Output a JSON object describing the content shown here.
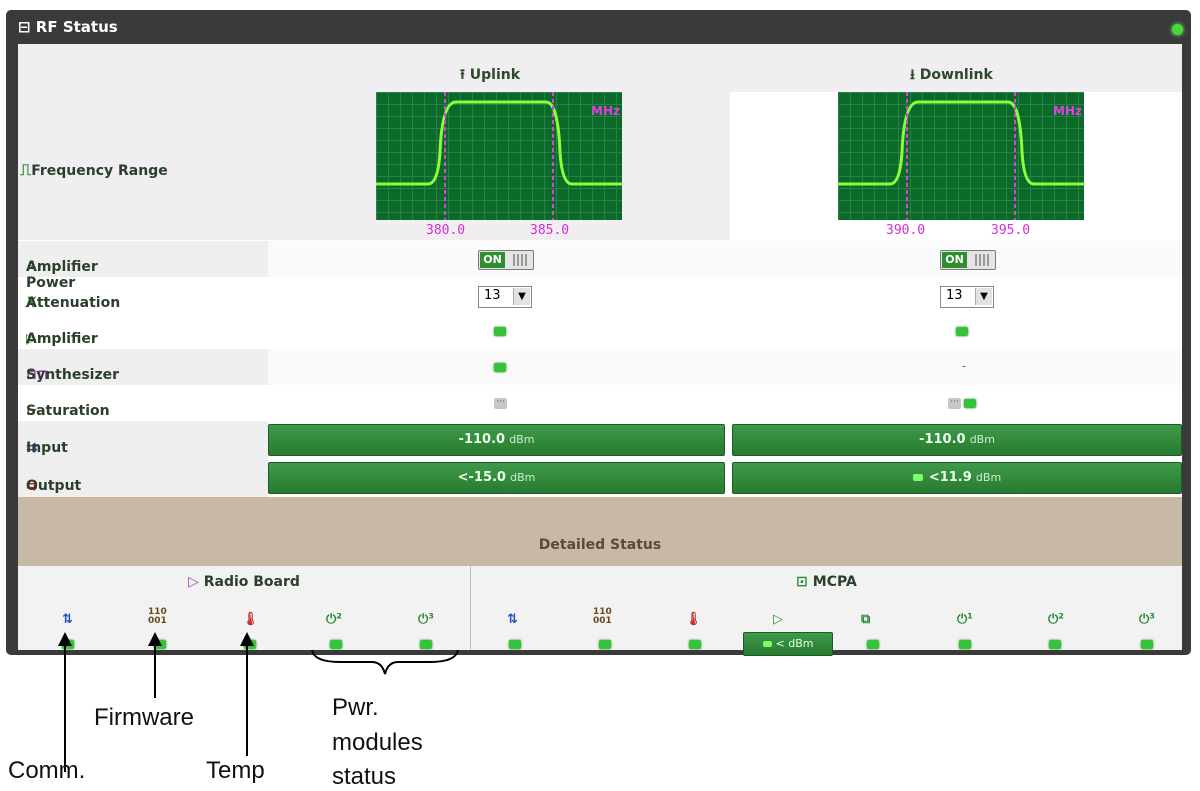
{
  "panel": {
    "title": "RF Status",
    "collapse_icon": "minus-box-icon"
  },
  "freq": {
    "uplink_label": "Uplink",
    "downlink_label": "Downlink",
    "row_label": "Frequency Range",
    "unit": "MHz",
    "uplink_low": "380.0",
    "uplink_high": "385.0",
    "downlink_low": "390.0",
    "downlink_high": "395.0"
  },
  "rows": {
    "amp_power": {
      "label": "Amplifier Power",
      "on": "ON"
    },
    "attenuation": {
      "label": "Attenuation",
      "uplink": "13",
      "downlink": "13"
    },
    "amplifier": {
      "label": "Amplifier"
    },
    "synth": {
      "label": "Synthesizer",
      "downlink": "-"
    },
    "saturation": {
      "label": "Saturation"
    },
    "input": {
      "label": "Input",
      "uplink_val": "-110.0",
      "downlink_val": "-110.0",
      "unit": "dBm"
    },
    "output": {
      "label": "Output",
      "uplink_val": "<-15.0",
      "downlink_val": "<11.9",
      "unit": "dBm"
    }
  },
  "detailed": {
    "title": "Detailed Status",
    "radio_board": "Radio Board",
    "mcpa": "MCPA",
    "mcpa_meter": "< dBm"
  },
  "annotations": {
    "firmware": "Firmware",
    "comm": "Comm.",
    "temp": "Temp",
    "pwr": "Pwr.",
    "modules": "modules",
    "status": "status"
  },
  "colors": {
    "led_green": "#36c23a",
    "scope_bg": "#0b6a2a",
    "freq_marker": "#d030d0"
  }
}
